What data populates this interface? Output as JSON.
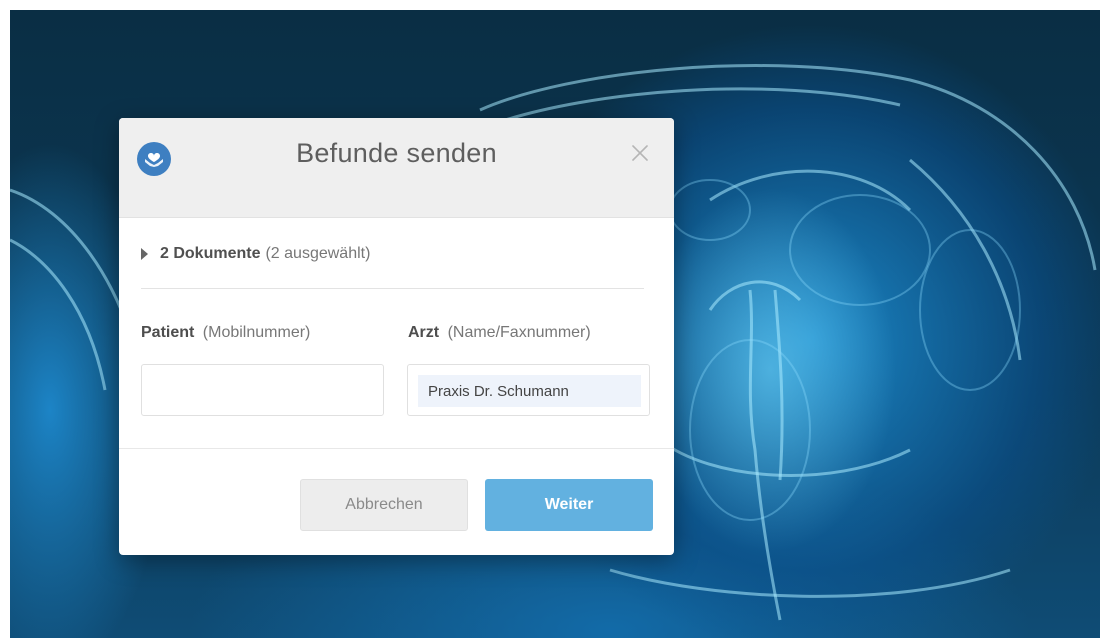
{
  "dialog": {
    "title": "Befunde senden",
    "logo_icon": "heart-hands-icon",
    "close_icon": "close-icon",
    "documents": {
      "count_label": "2 Dokumente",
      "selected_label": "(2 ausgewählt)"
    },
    "patient_field": {
      "label": "Patient",
      "hint": "(Mobilnummer)",
      "value": "",
      "placeholder": ""
    },
    "doctor_field": {
      "label": "Arzt",
      "hint": "(Name/Faxnummer)",
      "value": "Praxis Dr. Schumann"
    },
    "buttons": {
      "cancel": "Abbrechen",
      "next": "Weiter"
    }
  },
  "colors": {
    "accent": "#62b1e0",
    "logo": "#3e7fc1",
    "header_bg": "#efefef",
    "backdrop": "#0a2e44"
  }
}
